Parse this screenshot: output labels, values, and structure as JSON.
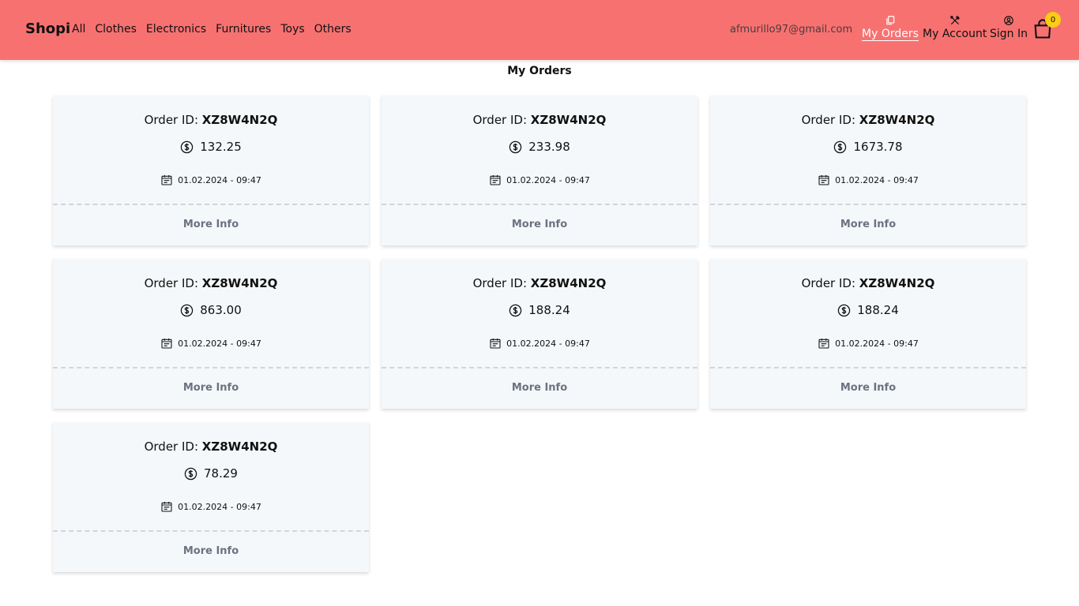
{
  "brand": "Shopi",
  "nav": {
    "categories": [
      "All",
      "Clothes",
      "Electronics",
      "Furnitures",
      "Toys",
      "Others"
    ],
    "email": "afmurillo97@gmail.com",
    "my_orders": "My Orders",
    "my_account": "My Account",
    "sign_in": "Sign In",
    "cart_count": "0"
  },
  "page_title": "My Orders",
  "orders": [
    {
      "label": "Order ID: ",
      "id": "XZ8W4N2Q",
      "price": "132.25",
      "date": "01.02.2024 - 09:47",
      "more": "More Info"
    },
    {
      "label": "Order ID: ",
      "id": "XZ8W4N2Q",
      "price": "233.98",
      "date": "01.02.2024 - 09:47",
      "more": "More Info"
    },
    {
      "label": "Order ID: ",
      "id": "XZ8W4N2Q",
      "price": "1673.78",
      "date": "01.02.2024 - 09:47",
      "more": "More Info"
    },
    {
      "label": "Order ID: ",
      "id": "XZ8W4N2Q",
      "price": "863.00",
      "date": "01.02.2024 - 09:47",
      "more": "More Info"
    },
    {
      "label": "Order ID: ",
      "id": "XZ8W4N2Q",
      "price": "188.24",
      "date": "01.02.2024 - 09:47",
      "more": "More Info"
    },
    {
      "label": "Order ID: ",
      "id": "XZ8W4N2Q",
      "price": "188.24",
      "date": "01.02.2024 - 09:47",
      "more": "More Info"
    },
    {
      "label": "Order ID: ",
      "id": "XZ8W4N2Q",
      "price": "78.29",
      "date": "01.02.2024 - 09:47",
      "more": "More Info"
    }
  ],
  "colors": {
    "navbar": "#f87171",
    "card_bg": "#f5f8fa",
    "badge": "#facc15",
    "more_info": "#6b7280"
  },
  "icons": {
    "orders": "clipboard-icon",
    "account": "tools-icon",
    "sign_in": "user-circle-icon",
    "cart": "shopping-bag-icon",
    "price": "dollar-circle-icon",
    "date": "calendar-icon"
  }
}
